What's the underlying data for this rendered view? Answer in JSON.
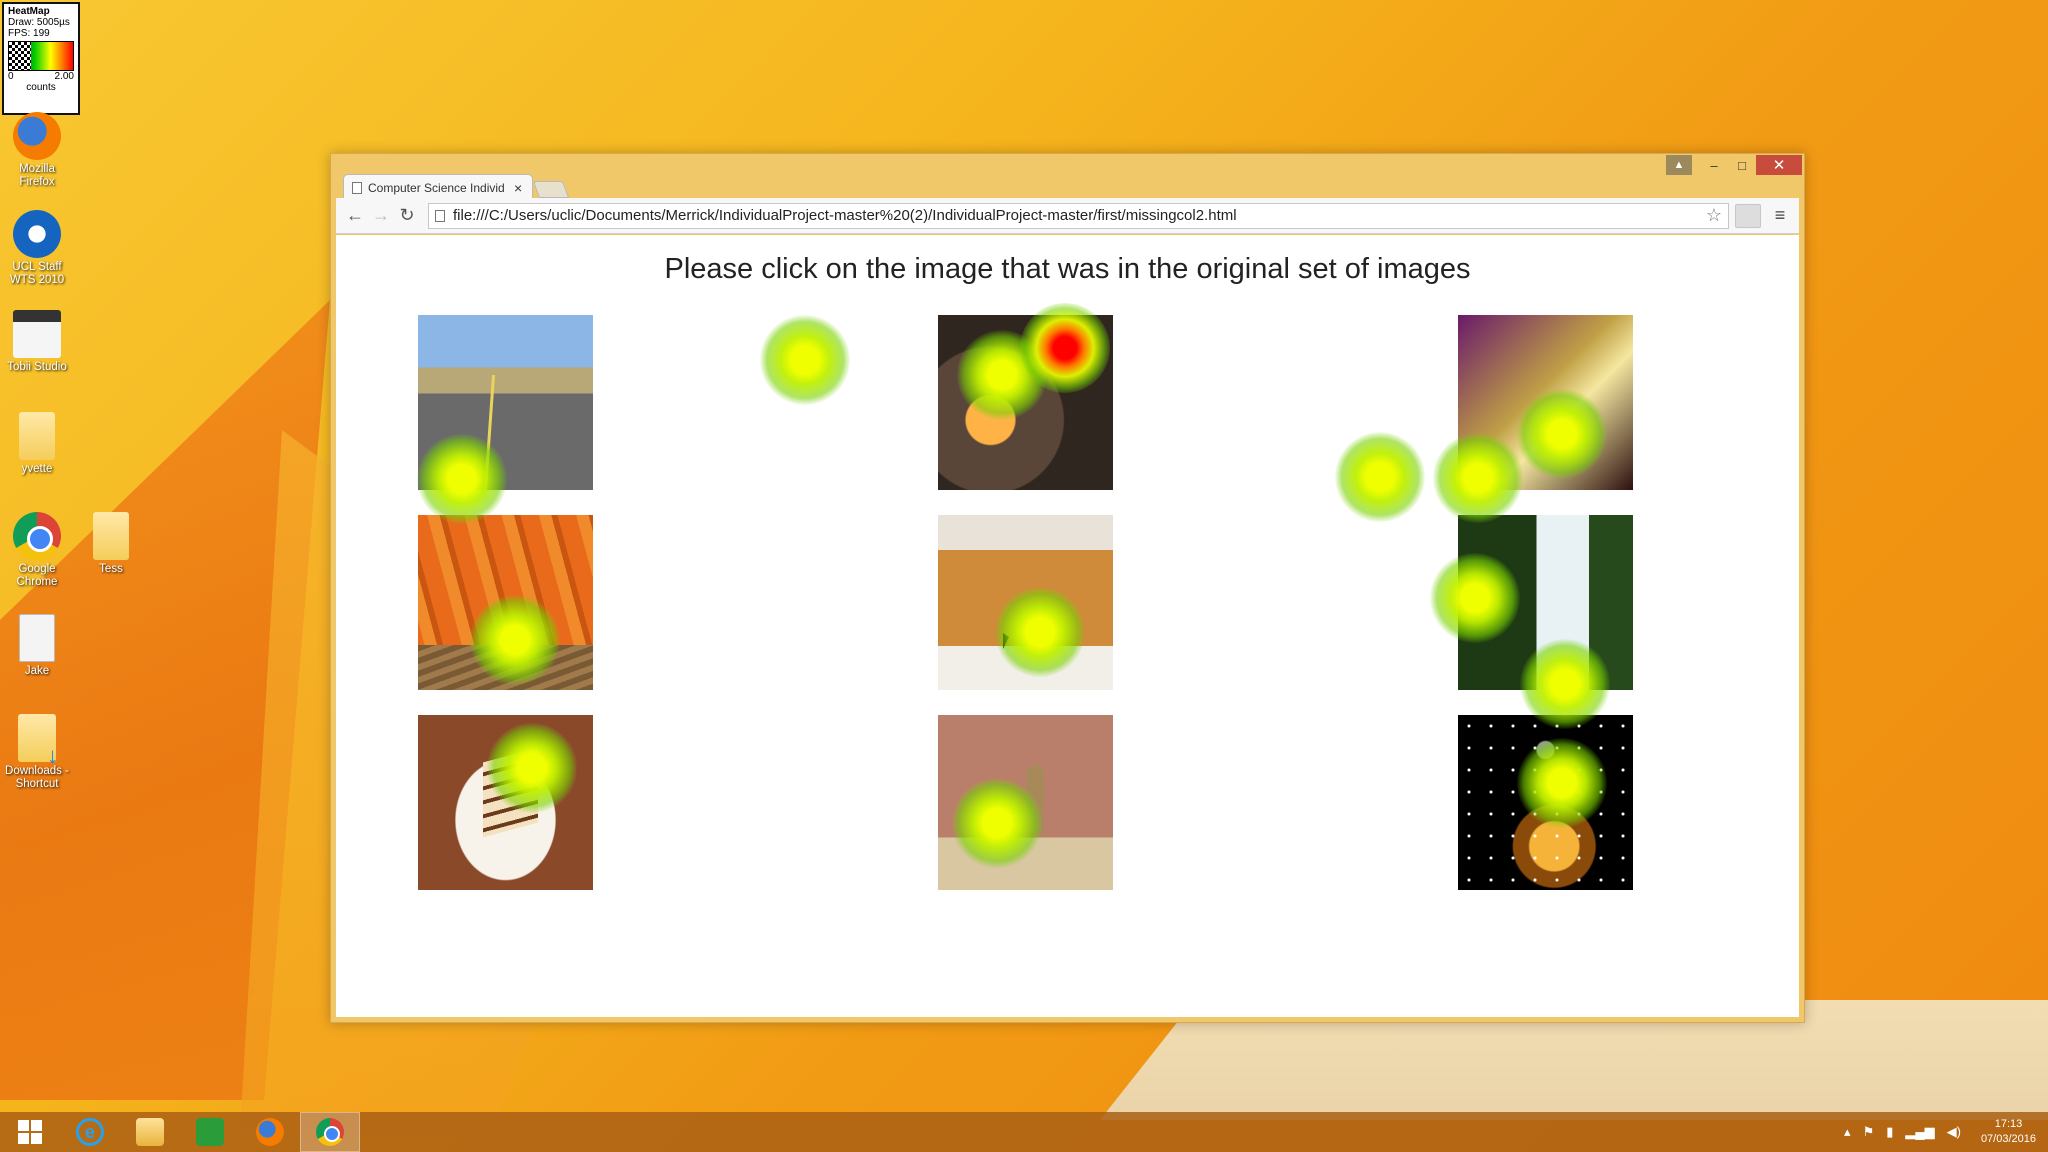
{
  "heatmap_legend": {
    "title": "HeatMap",
    "draw": "Draw: 5005µs",
    "fps": "FPS: 199",
    "min": "0",
    "max": "2.00",
    "unit": "counts"
  },
  "desktop_icons": [
    {
      "label": "Mozilla Firefox",
      "icon": "firefox-icon"
    },
    {
      "label": "UCL Staff WTS 2010",
      "icon": "remote-desktop-icon"
    },
    {
      "label": "Tobii Studio",
      "icon": "tobii-studio-icon"
    },
    {
      "label": "yvette",
      "icon": "folder-icon"
    },
    {
      "label": "Google Chrome",
      "icon": "chrome-icon"
    },
    {
      "label": "Tess",
      "icon": "folder-icon"
    },
    {
      "label": "Jake",
      "icon": "document-icon"
    },
    {
      "label": "Downloads - Shortcut",
      "icon": "downloads-folder-icon"
    }
  ],
  "browser": {
    "tab_title": "Computer Science Individ",
    "tab_close": "×",
    "url": "file:///C:/Users/uclic/Documents/Merrick/IndividualProject-master%20(2)/IndividualProject-master/first/missingcol2.html",
    "window_buttons": {
      "minimize": "–",
      "maximize": "□",
      "close": "✕"
    }
  },
  "page": {
    "prompt": "Please click on the image that was in the original set of images",
    "images": [
      {
        "name": "road",
        "row": 1,
        "col": 1
      },
      {
        "name": "lantern",
        "row": 1,
        "col": 2
      },
      {
        "name": "saxophone",
        "row": 1,
        "col": 3
      },
      {
        "name": "carrots",
        "row": 2,
        "col": 1
      },
      {
        "name": "toast",
        "row": 2,
        "col": 2
      },
      {
        "name": "waterfall",
        "row": 2,
        "col": 3
      },
      {
        "name": "cake",
        "row": 3,
        "col": 1
      },
      {
        "name": "meerkat",
        "row": 3,
        "col": 2
      },
      {
        "name": "candle",
        "row": 3,
        "col": 3
      }
    ]
  },
  "taskbar": {
    "items": [
      "start",
      "internet-explorer",
      "file-explorer",
      "store",
      "firefox",
      "chrome"
    ],
    "active": "chrome",
    "time": "17:13",
    "date": "07/03/2016"
  }
}
